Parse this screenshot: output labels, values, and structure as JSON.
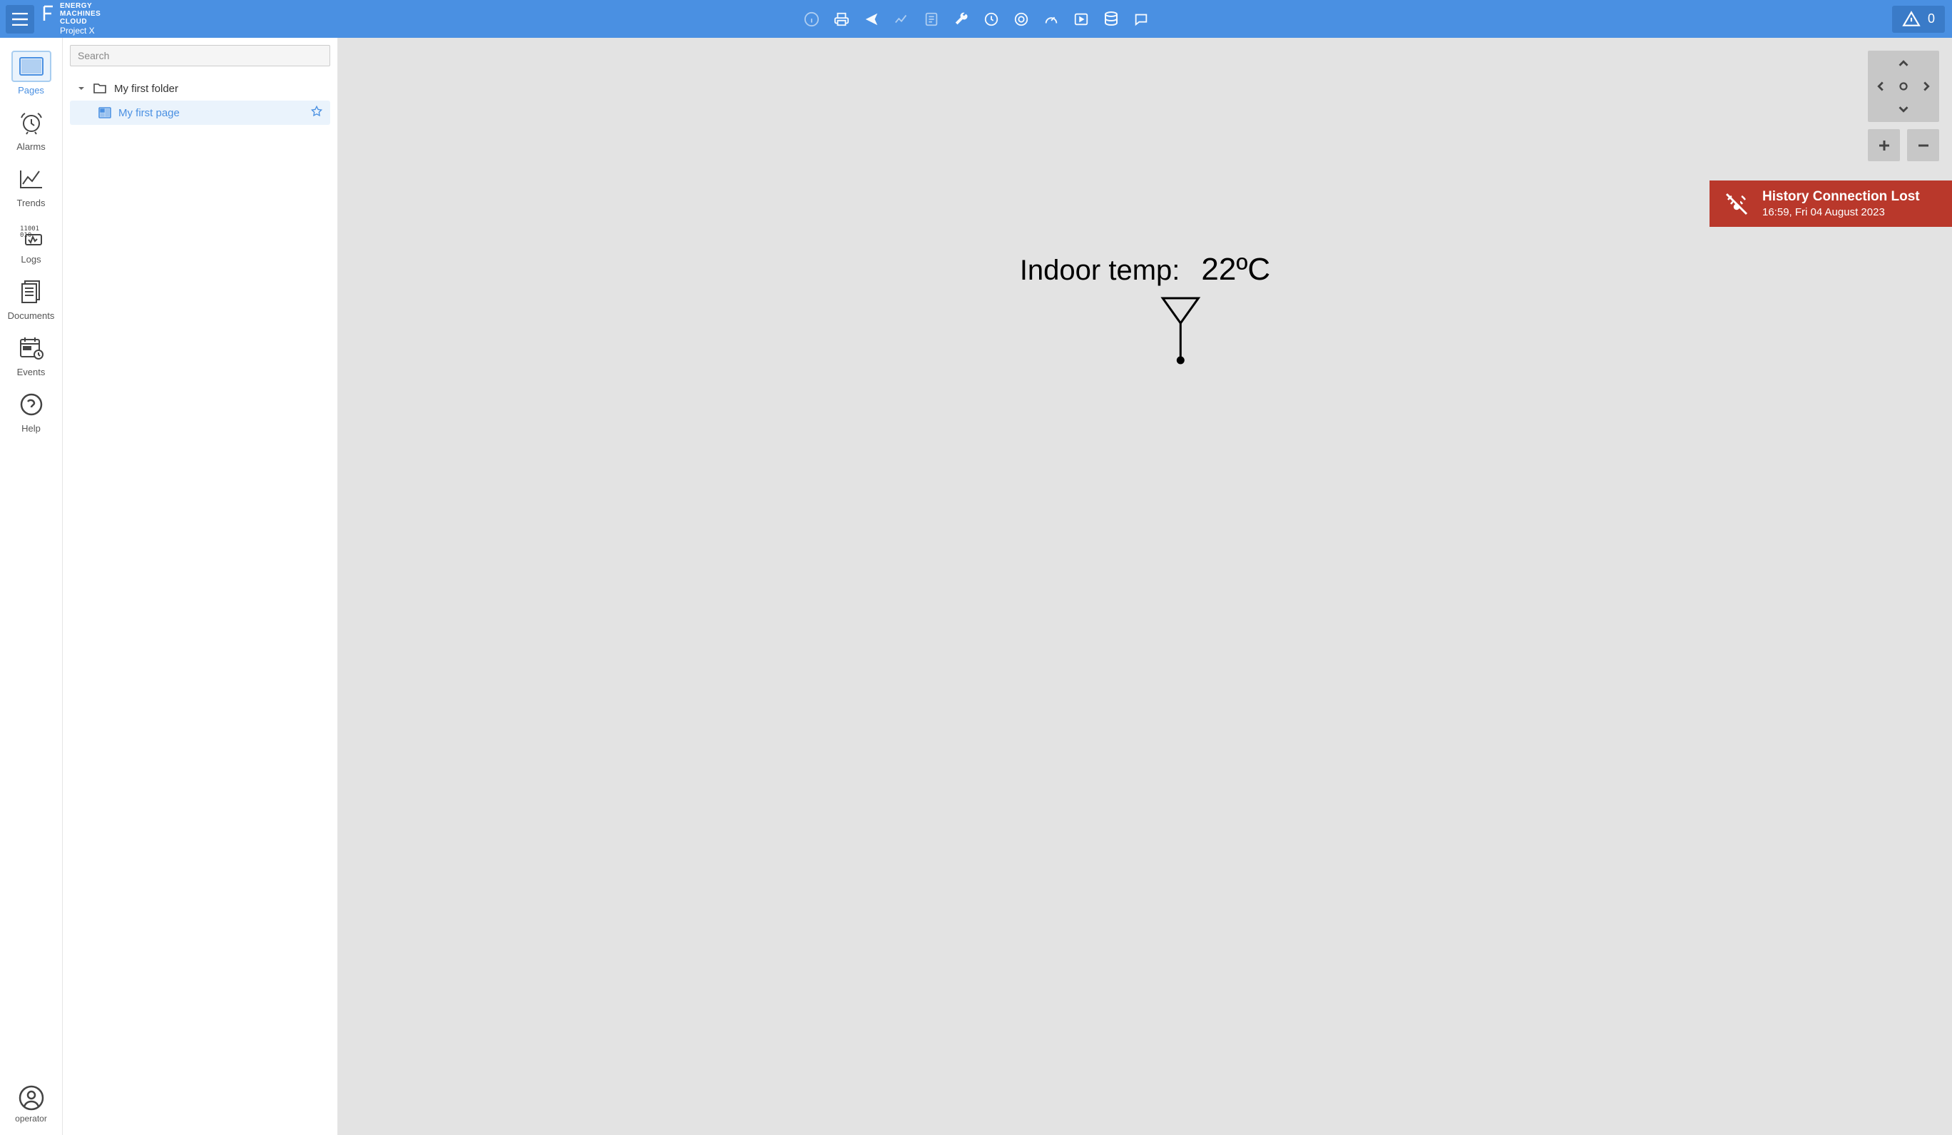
{
  "brand": {
    "line1": "ENERGY",
    "line2": "MACHINES",
    "line3": "CLOUD",
    "project": "Project X"
  },
  "header": {
    "alert_count": "0"
  },
  "search": {
    "placeholder": "Search"
  },
  "rail": {
    "pages": "Pages",
    "alarms": "Alarms",
    "trends": "Trends",
    "logs": "Logs",
    "documents": "Documents",
    "events": "Events",
    "help": "Help",
    "user": "operator"
  },
  "tree": {
    "folder": "My first folder",
    "page": "My first page"
  },
  "toast": {
    "title": "History Connection Lost",
    "subtitle": "16:59, Fri 04 August 2023"
  },
  "reading": {
    "label": "Indoor temp:",
    "value": "22ºC"
  }
}
